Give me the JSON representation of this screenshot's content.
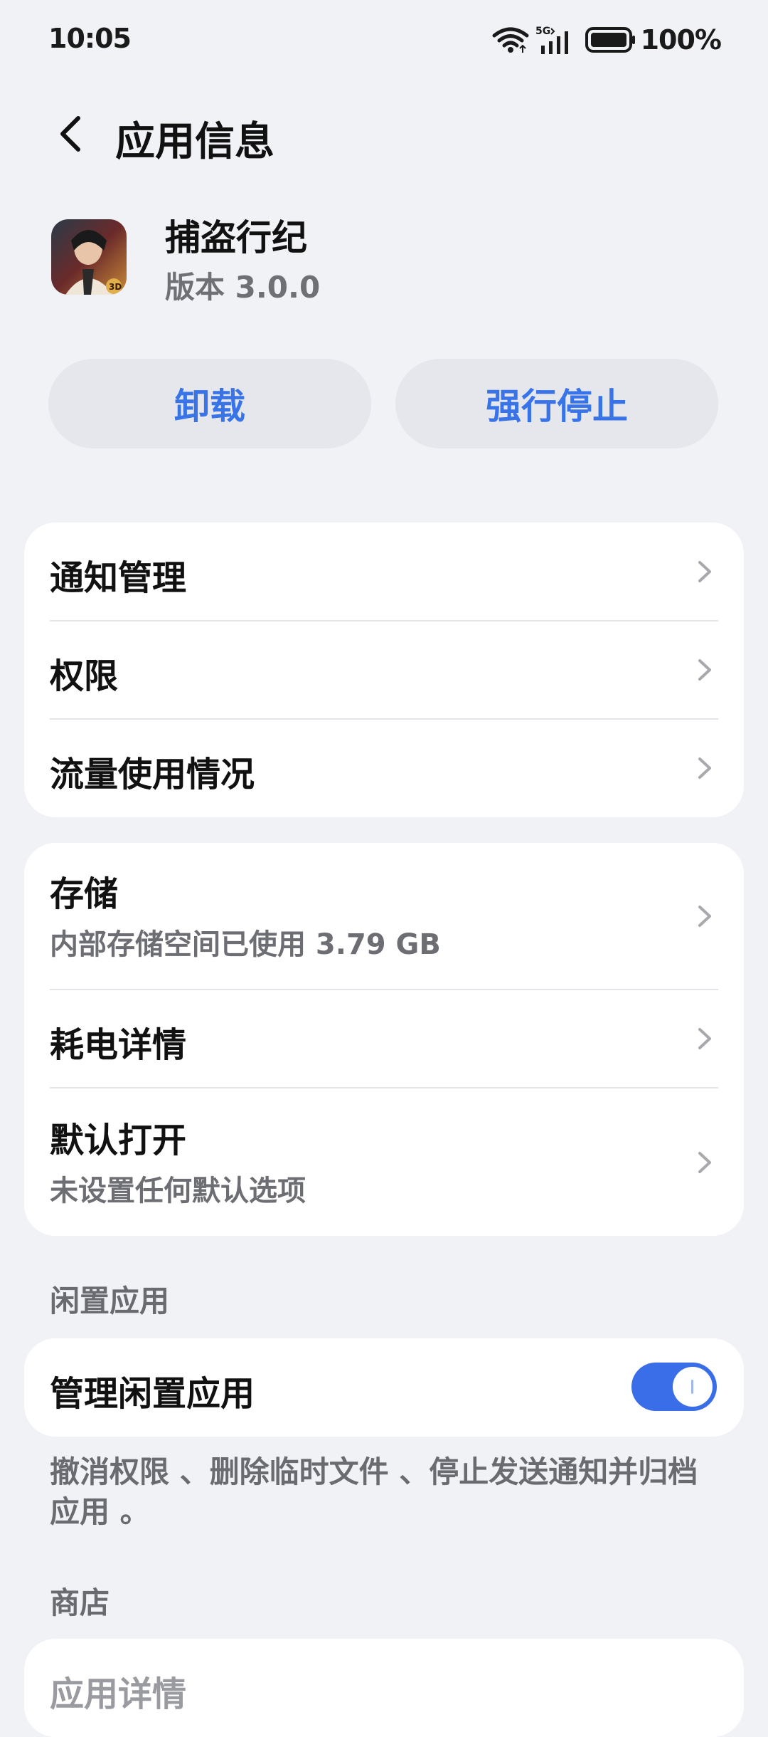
{
  "status_bar": {
    "time": "10:05",
    "network": "5G",
    "battery": "100%"
  },
  "header": {
    "title": "应用信息"
  },
  "app": {
    "name": "捕盗行纪",
    "version": "版本 3.0.0",
    "icon_badge": "3D"
  },
  "actions": {
    "uninstall_label": "卸载",
    "force_stop_label": "强行停止"
  },
  "card1": {
    "items": [
      {
        "label": "通知管理"
      },
      {
        "label": "权限"
      },
      {
        "label": "流量使用情况"
      }
    ]
  },
  "card2": {
    "items": [
      {
        "label": "存储",
        "sub": "内部存储空间已使用 3.79 GB"
      },
      {
        "label": "耗电详情"
      },
      {
        "label": "默认打开",
        "sub": "未设置任何默认选项"
      }
    ]
  },
  "idle_section": {
    "header": "闲置应用",
    "manage_label": "管理闲置应用",
    "toggle_on": true,
    "description": "撤消权限 、删除临时文件 、停止发送通知并归档应用 。"
  },
  "store_section": {
    "header": "商店",
    "details_label": "应用详情"
  },
  "colors": {
    "accent": "#3873e8",
    "background": "#f1f2f6",
    "card": "#ffffff",
    "secondary_text": "#6d6e73"
  },
  "icons": [
    "wifi-icon",
    "signal-icon",
    "battery-icon",
    "back-arrow-icon",
    "chevron-right-icon"
  ]
}
